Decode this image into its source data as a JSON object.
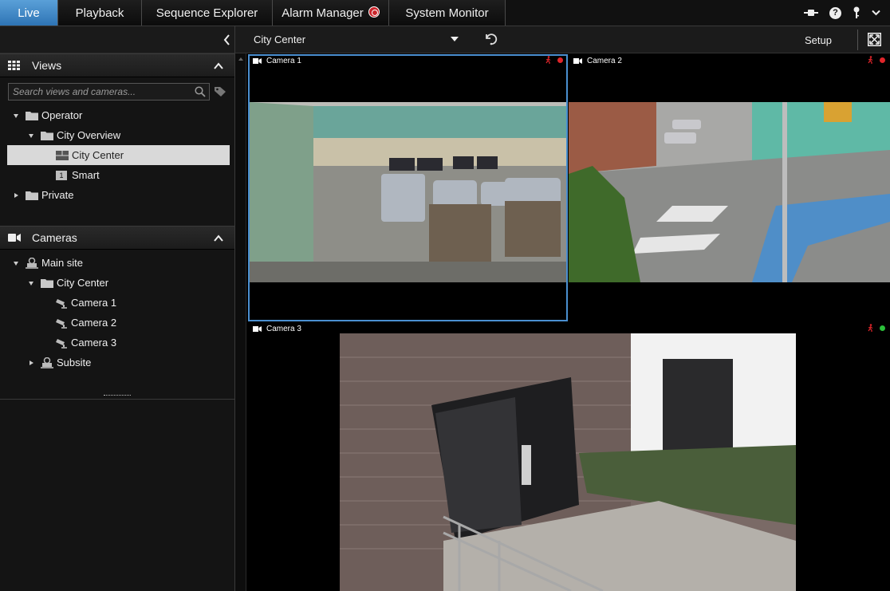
{
  "tabs": [
    {
      "label": "Live",
      "active": true
    },
    {
      "label": "Playback"
    },
    {
      "label": "Sequence Explorer"
    },
    {
      "label": "Alarm Manager",
      "badge": true
    },
    {
      "label": "System Monitor"
    }
  ],
  "colors": {
    "accent": "#3a86c8",
    "recording": "#e0252a",
    "connected": "#2bbf3a",
    "motion": "#e0252a"
  },
  "views_panel": {
    "title": "Views",
    "search_placeholder": "Search views and cameras...",
    "tree": [
      {
        "label": "Operator",
        "level": 0,
        "expanded": true,
        "icon": "folder-icon"
      },
      {
        "label": "City Overview",
        "level": 1,
        "expanded": true,
        "icon": "folder-icon"
      },
      {
        "label": "City Center",
        "level": 2,
        "selected": true,
        "icon": "layout-2x2-icon"
      },
      {
        "label": "Smart",
        "level": 2,
        "icon": "layout-1-icon",
        "icon_text": "1"
      },
      {
        "label": "Private",
        "level": 0,
        "expanded": false,
        "icon": "folder-icon"
      }
    ]
  },
  "cameras_panel": {
    "title": "Cameras",
    "tree": [
      {
        "label": "Main site",
        "level": 0,
        "expanded": true,
        "icon": "server-icon"
      },
      {
        "label": "City Center",
        "level": 1,
        "expanded": true,
        "icon": "folder-icon"
      },
      {
        "label": "Camera 1",
        "level": 2,
        "icon": "camera-icon"
      },
      {
        "label": "Camera 2",
        "level": 2,
        "icon": "camera-icon"
      },
      {
        "label": "Camera 3",
        "level": 2,
        "icon": "camera-icon"
      },
      {
        "label": "Subsite",
        "level": 1,
        "expanded": false,
        "icon": "server-icon"
      }
    ]
  },
  "viewbar": {
    "current_view": "City Center",
    "setup_label": "Setup"
  },
  "cameras": [
    {
      "name": "Camera 1",
      "status_color": "recording",
      "selected": true
    },
    {
      "name": "Camera 2",
      "status_color": "recording"
    },
    {
      "name": "Camera 3",
      "status_color": "connected"
    }
  ]
}
